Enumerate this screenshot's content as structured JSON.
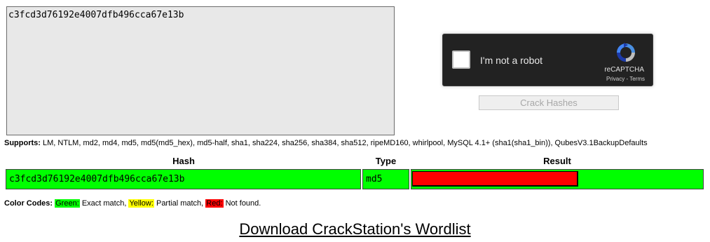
{
  "hash_input": {
    "value": "c3fcd3d76192e4007dfb496cca67e13b"
  },
  "captcha": {
    "label": "I'm not a robot",
    "brand": "reCAPTCHA",
    "privacy": "Privacy",
    "separator": " - ",
    "terms": "Terms"
  },
  "crack_button": {
    "label": "Crack Hashes"
  },
  "supports": {
    "label": "Supports:",
    "text": " LM, NTLM, md2, md4, md5, md5(md5_hex), md5-half, sha1, sha224, sha256, sha384, sha512, ripeMD160, whirlpool, MySQL 4.1+ (sha1(sha1_bin)), QubesV3.1BackupDefaults"
  },
  "results_table": {
    "headers": {
      "hash": "Hash",
      "type": "Type",
      "result": "Result"
    },
    "rows": [
      {
        "hash": "c3fcd3d76192e4007dfb496cca67e13b",
        "type": "md5",
        "result": ""
      }
    ]
  },
  "color_codes": {
    "label": "Color Codes:",
    "green": "Green:",
    "green_desc": " Exact match, ",
    "yellow": "Yellow:",
    "yellow_desc": " Partial match, ",
    "red": "Red:",
    "red_desc": " Not found."
  },
  "download_link": {
    "text": "Download CrackStation's Wordlist"
  },
  "colors": {
    "exact_match": "#00ff00",
    "partial_match": "#ffff00",
    "not_found": "#ff0000",
    "captcha_bg": "#222222"
  }
}
